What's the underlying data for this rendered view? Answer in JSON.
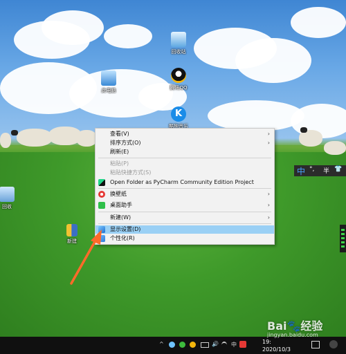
{
  "desktop": {
    "icons": [
      {
        "label": "此电脑"
      },
      {
        "label": "回收站"
      },
      {
        "label": "腾讯QQ"
      },
      {
        "label": "酷狗音乐"
      },
      {
        "label": "回收"
      },
      {
        "label": "新建"
      }
    ]
  },
  "context_menu": {
    "items": [
      {
        "label": "查看(V)",
        "has_submenu": true
      },
      {
        "label": "排序方式(O)",
        "has_submenu": true
      },
      {
        "label": "刷新(E)"
      },
      {
        "label": "粘贴(P)",
        "disabled": true
      },
      {
        "label": "粘贴快捷方式(S)",
        "disabled": true
      },
      {
        "label": "Open Folder as PyCharm Community Edition Project",
        "icon": "pycharm-icon"
      },
      {
        "label": "换壁纸",
        "icon": "wallpaper-icon",
        "has_submenu": true
      },
      {
        "label": "桌面助手",
        "icon": "desktop-assistant-icon",
        "has_submenu": true
      },
      {
        "label": "新建(W)",
        "has_submenu": true
      },
      {
        "label": "显示设置(D)",
        "icon": "display-settings-icon",
        "highlighted": true
      },
      {
        "label": "个性化(R)",
        "icon": "personalize-icon"
      }
    ],
    "submenu_arrow": "›",
    "highlight_color": "#9ad0f5"
  },
  "ime_bar": {
    "lang": "中",
    "punct": "°,",
    "width": "半",
    "shirt": "👕"
  },
  "taskbar": {
    "chevron": "^",
    "input_lang": "中",
    "date": "2020/10/3",
    "time": "19:"
  },
  "watermark": {
    "brand": "Bai",
    "paw": "🐾",
    "suffix": "经验",
    "url": "jingyan.baidu.com"
  },
  "colors": {
    "arrow": "#ff6a2a"
  }
}
